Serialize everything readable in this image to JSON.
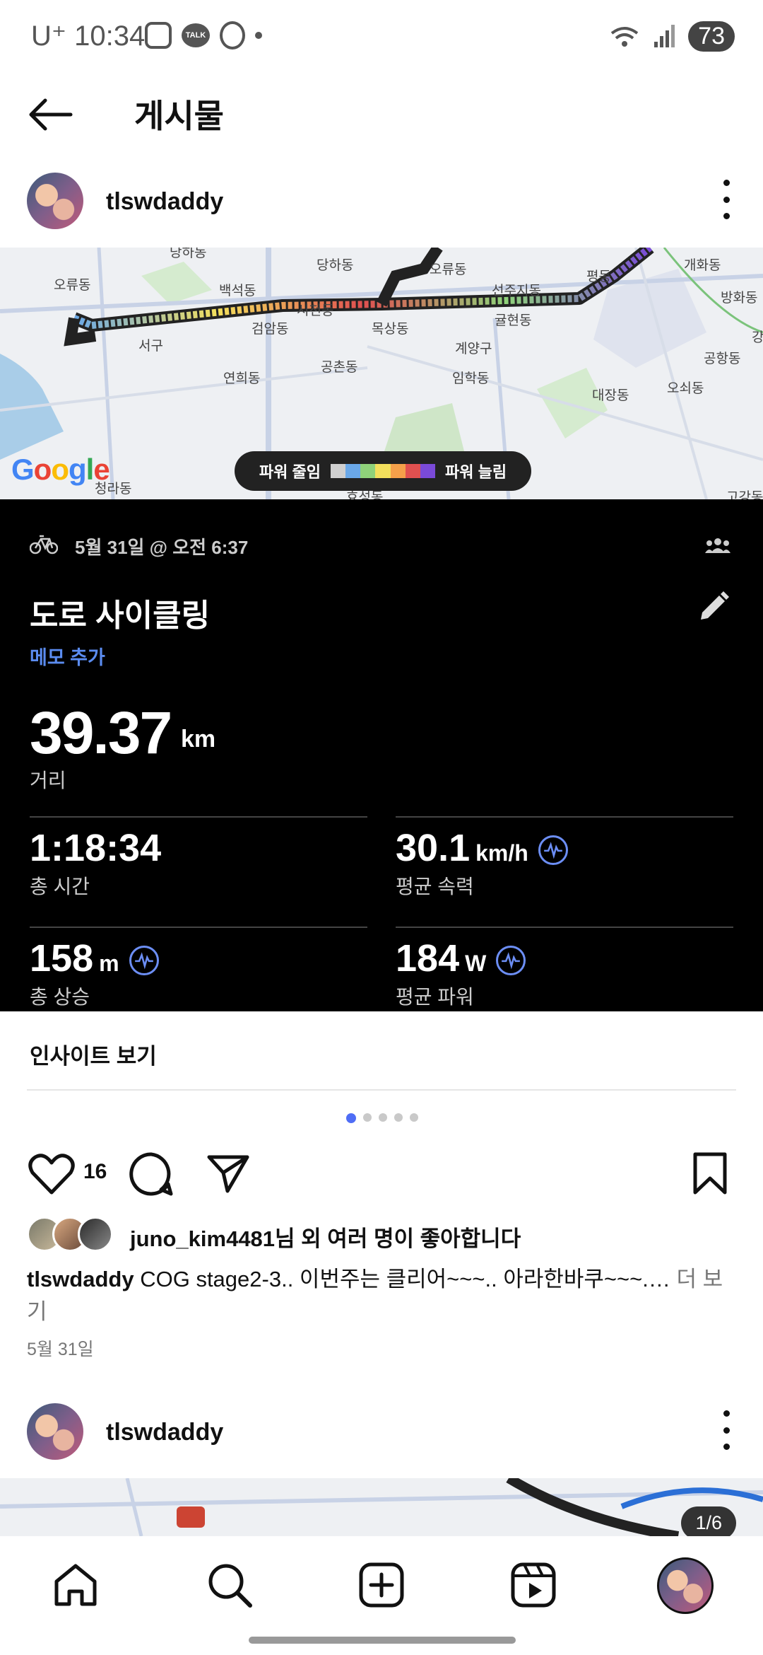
{
  "status_bar": {
    "carrier": "U⁺",
    "time": "10:34",
    "talk_label": "TALK",
    "battery": "73"
  },
  "header": {
    "title": "게시물"
  },
  "post": {
    "username": "tlswdaddy",
    "map": {
      "labels": [
        "당하동",
        "오류동",
        "개화동",
        "오류동",
        "백석동",
        "선주지동",
        "평동",
        "방화동",
        "시천동",
        "검암동",
        "목상동",
        "귤현동",
        "강",
        "서구",
        "계양구",
        "공항동",
        "공촌동",
        "연희동",
        "임학동",
        "오쇠동",
        "대장동",
        "청라동",
        "효성동",
        "고강동"
      ],
      "google_logo": "Google",
      "legend_left": "파워 줄임",
      "legend_right": "파워 늘림",
      "legend_colors": [
        "#cfcfcf",
        "#6aa8e8",
        "#8fd27a",
        "#f3df5c",
        "#f5a04a",
        "#e05050",
        "#7a4ad8"
      ]
    },
    "activity": {
      "date": "5월 31일 @ 오전 6:37",
      "title": "도로 사이클링",
      "memo_label": "메모 추가",
      "distance_value": "39.37",
      "distance_unit": "km",
      "distance_label": "거리",
      "total_time_value": "1:18:34",
      "total_time_label": "총 시간",
      "avg_speed_value": "30.1",
      "avg_speed_unit": "km/h",
      "avg_speed_label": "평균 속력",
      "elevation_value": "158",
      "elevation_unit": "m",
      "elevation_label": "총 상승",
      "avg_power_value": "184",
      "avg_power_unit": "W",
      "avg_power_label": "평균 파워"
    },
    "insight_label": "인사이트 보기",
    "carousel": {
      "count": 5,
      "active_index": 0
    },
    "like_count": "16",
    "liked_by": "juno_kim4481님 외 여러 명이 좋아합니다",
    "caption_user": "tlswdaddy",
    "caption_text": "COG stage2-3.. 이번주는 클리어~~~.. 아라한바쿠~~~.…",
    "more_label": "더 보기",
    "post_date": "5월 31일"
  },
  "next_post": {
    "username": "tlswdaddy",
    "pager": "1/6"
  },
  "accent_color": "#4f6df5"
}
